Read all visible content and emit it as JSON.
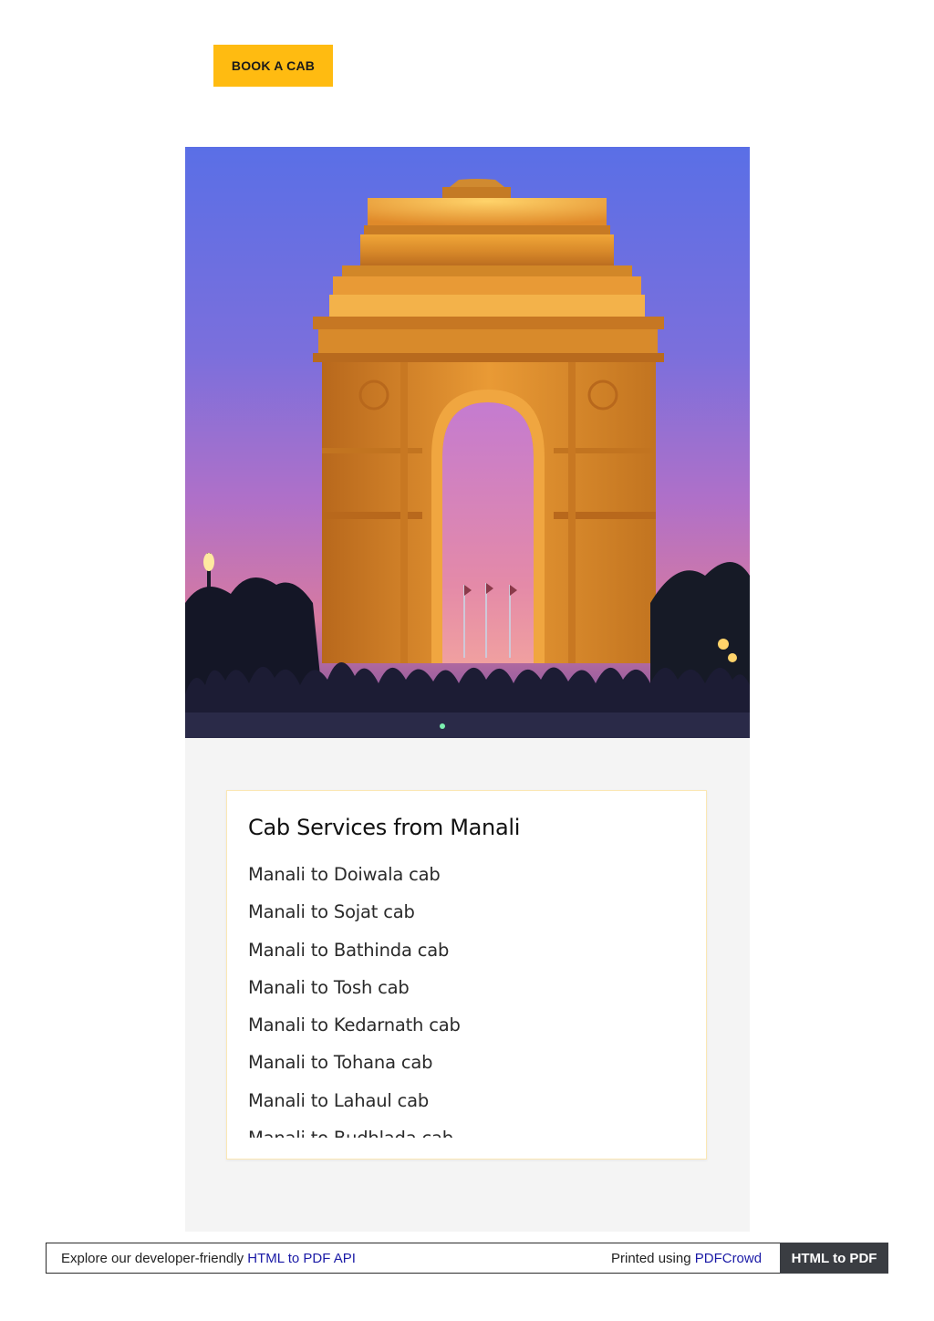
{
  "header": {
    "book_button_label": "BOOK A CAB",
    "accent_color": "#ffbb11"
  },
  "hero": {
    "image_alt": "India Gate at dusk",
    "icon": "india-gate-image"
  },
  "card": {
    "title": "Cab Services from Manali",
    "items": [
      "Manali to Doiwala cab",
      "Manali to Sojat cab",
      "Manali to Bathinda cab",
      "Manali to Tosh cab",
      "Manali to Kedarnath cab",
      "Manali to Tohana cab",
      "Manali to Lahaul cab",
      "Manali to Budhlada cab"
    ]
  },
  "footer": {
    "explore_text": "Explore our developer-friendly ",
    "api_link": "HTML to PDF API",
    "printed_text": "Printed using ",
    "pdfcrowd_link": "PDFCrowd",
    "badge_label": "HTML to PDF",
    "link_color": "#1a1aa6",
    "badge_color": "#3a3d42"
  }
}
